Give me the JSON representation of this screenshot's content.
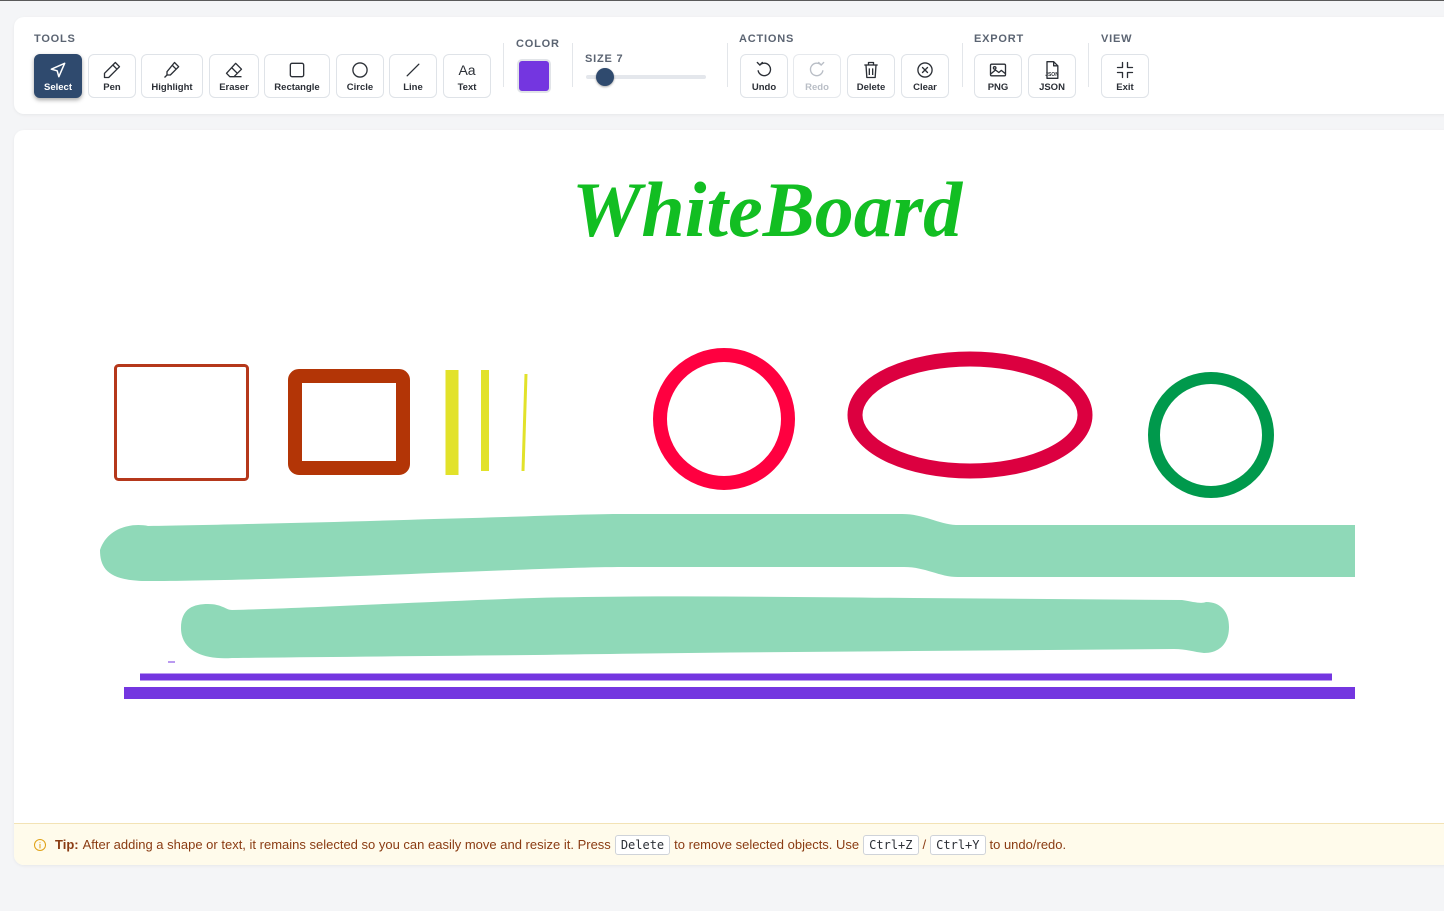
{
  "toolbar": {
    "groups": {
      "tools": "TOOLS",
      "color": "COLOR",
      "size": "SIZE 7",
      "actions": "ACTIONS",
      "export": "EXPORT",
      "view": "VIEW"
    },
    "tools": [
      {
        "label": "Select",
        "icon": "cursor-arrow-icon",
        "active": true
      },
      {
        "label": "Pen",
        "icon": "pen-icon"
      },
      {
        "label": "Highlight",
        "icon": "highlighter-icon"
      },
      {
        "label": "Eraser",
        "icon": "eraser-icon"
      },
      {
        "label": "Rectangle",
        "icon": "square-icon"
      },
      {
        "label": "Circle",
        "icon": "circle-icon"
      },
      {
        "label": "Line",
        "icon": "line-icon"
      },
      {
        "label": "Text",
        "icon": "text-aa-icon",
        "glyph": "Aa"
      }
    ],
    "color_value": "#7436e0",
    "size_value": 7,
    "actions": [
      {
        "label": "Undo",
        "icon": "undo-icon"
      },
      {
        "label": "Redo",
        "icon": "redo-icon",
        "disabled": true
      },
      {
        "label": "Delete",
        "icon": "trash-icon"
      },
      {
        "label": "Clear",
        "icon": "clear-x-circle-icon"
      }
    ],
    "export": [
      {
        "label": "PNG",
        "icon": "image-icon"
      },
      {
        "label": "JSON",
        "icon": "json-file-icon",
        "glyph": "JSON"
      }
    ],
    "view": [
      {
        "label": "Exit",
        "icon": "exit-fullscreen-icon"
      }
    ]
  },
  "board": {
    "title": "WhiteBoard",
    "colors": {
      "title": "#12be22",
      "rect_outline": "#b5381b",
      "rect_thick": "#b33506",
      "yellow": "#e2e22a",
      "red_circle": "#ff0040",
      "crimson_ellipse": "#dc0040",
      "green_circle": "#00994c",
      "highlight": "#8fd9b8",
      "purple": "#7436e0"
    }
  },
  "tip": {
    "icon": "info-circle-icon",
    "label": "Tip:",
    "text1": "After adding a shape or text, it remains selected so you can easily move and resize it. Press",
    "key_delete": "Delete",
    "text2": "to remove selected objects. Use",
    "key_undo": "Ctrl+Z",
    "sep": "/",
    "key_redo": "Ctrl+Y",
    "text3": "to undo/redo."
  }
}
